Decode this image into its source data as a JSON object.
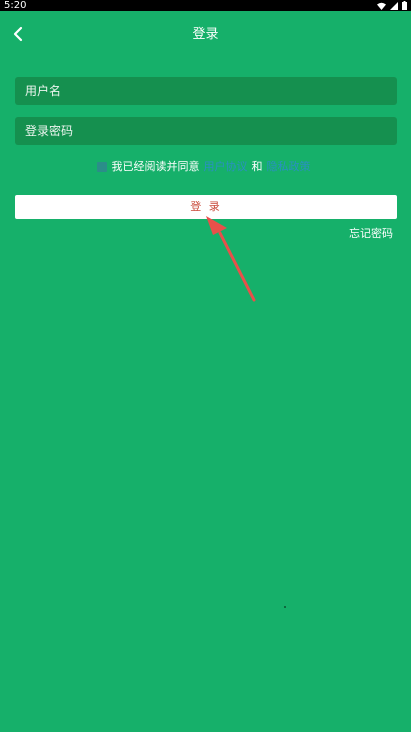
{
  "status_bar": {
    "time": "5:20",
    "icons": [
      "wifi-icon",
      "signal-icon",
      "battery-icon"
    ]
  },
  "header": {
    "title": "登录",
    "back_icon": "chevron-left-icon"
  },
  "form": {
    "username_placeholder": "用户名",
    "password_placeholder": "登录密码"
  },
  "agreement": {
    "prefix": "我已经阅读并同意",
    "user_agreement": "用户协议",
    "conjunction": "和",
    "privacy_policy": "隐私政策"
  },
  "actions": {
    "login_label": "登 录",
    "forgot_password": "忘记密码"
  },
  "colors": {
    "background": "#16b06a",
    "input_background": "#15904f",
    "link": "#2a90c2",
    "login_text": "#c94a3a",
    "annotation_arrow": "#e8504a"
  }
}
